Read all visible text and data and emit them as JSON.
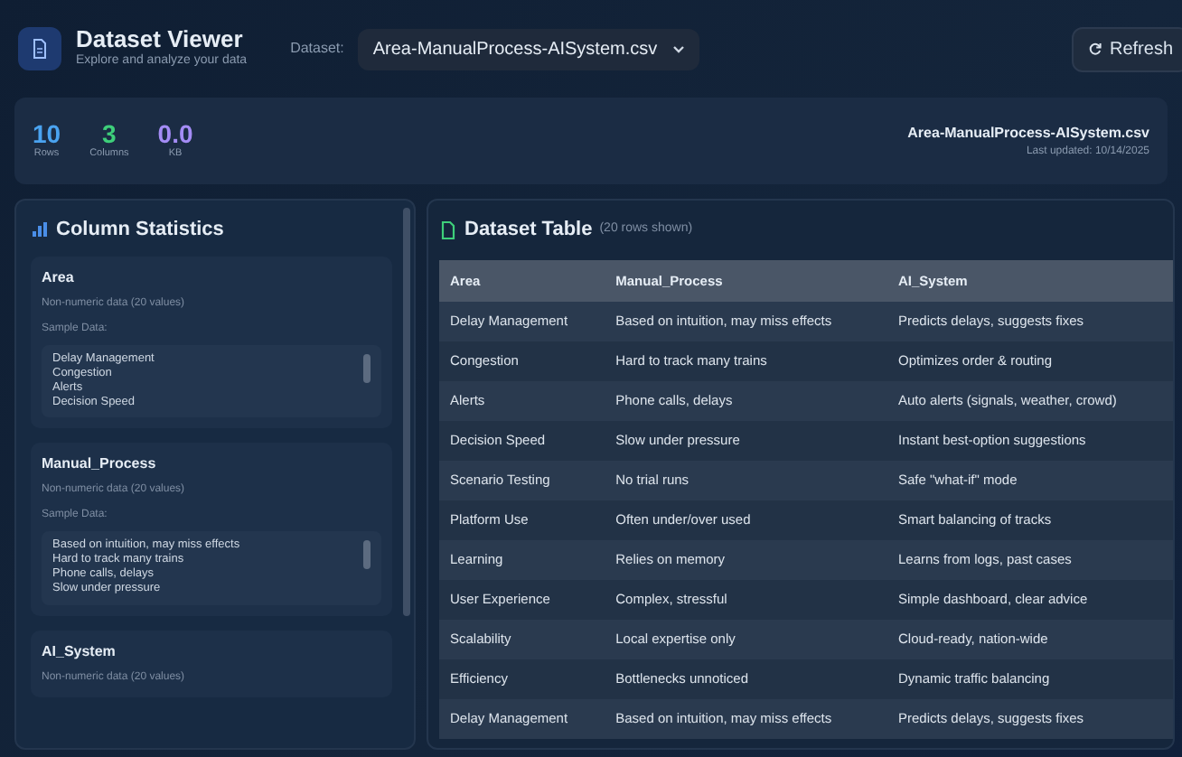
{
  "header": {
    "title": "Dataset Viewer",
    "subtitle": "Explore and analyze your data",
    "dataset_label": "Dataset:",
    "dataset_value": "Area-ManualProcess-AISystem.csv",
    "refresh": "Refresh"
  },
  "stats": [
    {
      "value": "10",
      "label": "Rows",
      "color": "#4aa3f0"
    },
    {
      "value": "3",
      "label": "Columns",
      "color": "#3ecf7a"
    },
    {
      "value": "0.0",
      "label": "KB",
      "color": "#a48cf5"
    }
  ],
  "file_info": {
    "name": "Area-ManualProcess-AISystem.csv",
    "updated": "Last updated: 10/14/2025"
  },
  "column_statistics": {
    "title": "Column Statistics",
    "columns": [
      {
        "name": "Area",
        "info": "Non-numeric data (20 values)",
        "sample_label": "Sample Data:",
        "samples": [
          "Delay Management",
          "Congestion",
          "Alerts",
          "Decision Speed"
        ]
      },
      {
        "name": "Manual_Process",
        "info": "Non-numeric data (20 values)",
        "sample_label": "Sample Data:",
        "samples": [
          "Based on intuition, may miss effects",
          "Hard to track many trains",
          "Phone calls, delays",
          "Slow under pressure"
        ]
      },
      {
        "name": "AI_System",
        "info": "Non-numeric data (20 values)"
      }
    ]
  },
  "table": {
    "title": "Dataset Table",
    "note": "(20 rows shown)",
    "columns": [
      "Area",
      "Manual_Process",
      "AI_System"
    ],
    "rows": [
      [
        "Delay Management",
        "Based on intuition, may miss effects",
        "Predicts delays, suggests fixes"
      ],
      [
        "Congestion",
        "Hard to track many trains",
        "Optimizes order & routing"
      ],
      [
        "Alerts",
        "Phone calls, delays",
        "Auto alerts (signals, weather, crowd)"
      ],
      [
        "Decision Speed",
        "Slow under pressure",
        "Instant best-option suggestions"
      ],
      [
        "Scenario Testing",
        "No trial runs",
        "Safe \"what-if\" mode"
      ],
      [
        "Platform Use",
        "Often under/over used",
        "Smart balancing of tracks"
      ],
      [
        "Learning",
        "Relies on memory",
        "Learns from logs, past cases"
      ],
      [
        "User Experience",
        "Complex, stressful",
        "Simple dashboard, clear advice"
      ],
      [
        "Scalability",
        "Local expertise only",
        "Cloud-ready, nation-wide"
      ],
      [
        "Efficiency",
        "Bottlenecks unnoticed",
        "Dynamic traffic balancing"
      ],
      [
        "Delay Management",
        "Based on intuition, may miss effects",
        "Predicts delays, suggests fixes"
      ]
    ]
  }
}
